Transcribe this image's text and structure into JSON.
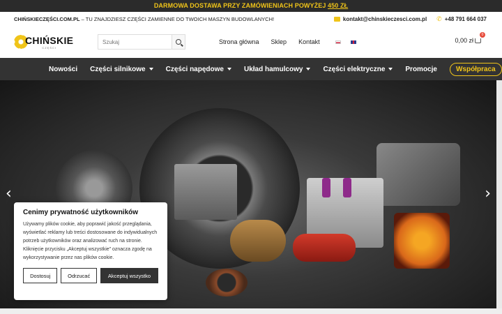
{
  "promo": {
    "text": "DARMOWA DOSTAWA PRZY ZAMÓWIENIACH POWYŻEJ",
    "amount": "450 ZŁ"
  },
  "infobar": {
    "site": "CHIŃSKIECZĘŚCI.COM.PL",
    "tagline": " – TU ZNAJDZIESZ CZĘŚCI ZAMIENNE DO TWOICH MASZYN BUDOWLANYCH!",
    "email": "kontakt@chinskieczesci.com.pl",
    "phone": "+48 791 664 037"
  },
  "header": {
    "logo_name": "CHIŃSKIE",
    "logo_sub": "CZĘŚCI",
    "search_placeholder": "Szukaj",
    "nav": [
      "Strona główna",
      "Sklep",
      "Kontakt"
    ],
    "cart_total": "0,00 zł",
    "cart_count": "0"
  },
  "mainnav": {
    "items": [
      "Nowości",
      "Części silnikowe",
      "Części napędowe",
      "Układ hamulcowy",
      "Części elektryczne",
      "Promocje"
    ],
    "cta": "Współpraca"
  },
  "hero": {
    "prev": "‹",
    "next": "›"
  },
  "cookie": {
    "title": "Cenimy prywatność użytkowników",
    "body": "Używamy plików cookie, aby poprawić jakość przeglądania, wyświetlać reklamy lub treści dostosowane do indywidualnych potrzeb użytkowników oraz analizować ruch na stronie. Kliknięcie przycisku „Akceptuj wszystkie” oznacza zgodę na wykorzystywanie przez nas plików cookie.",
    "btn_customize": "Dostosuj",
    "btn_reject": "Odrzucać",
    "btn_accept": "Akceptuj wszystko"
  },
  "colors": {
    "accent": "#f0c419",
    "nav_bg": "#333333",
    "promo_bg": "#2b2b2b"
  }
}
